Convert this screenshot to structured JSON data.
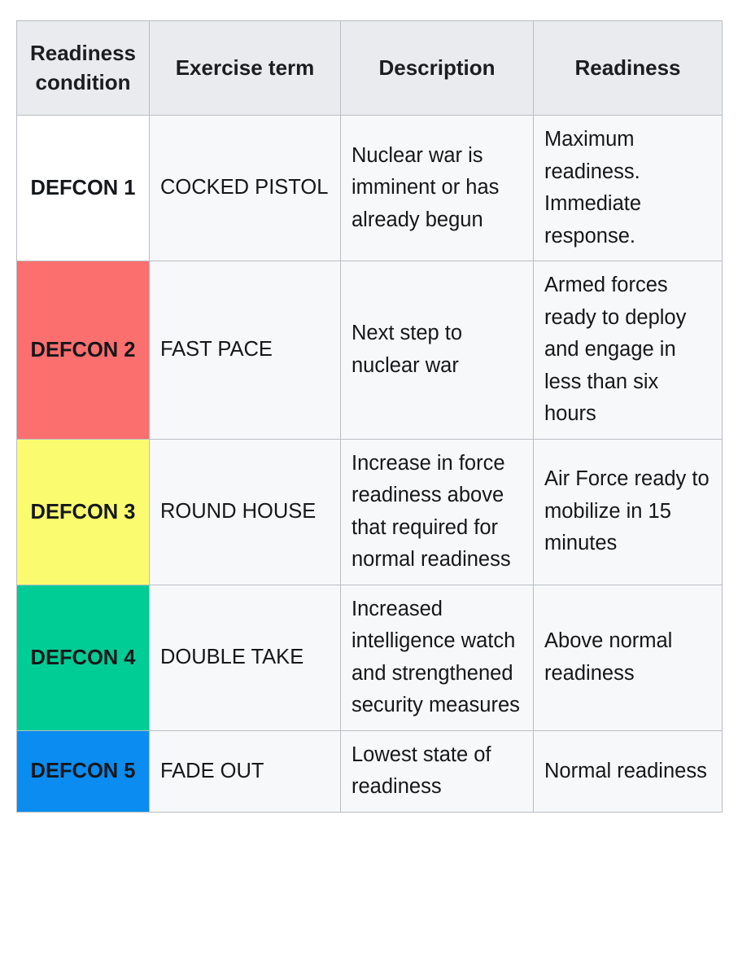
{
  "table": {
    "name": "defcon-readiness-table",
    "columns": [
      {
        "key": "condition",
        "label": "Readiness condition"
      },
      {
        "key": "term",
        "label": "Exercise term"
      },
      {
        "key": "description",
        "label": "Description"
      },
      {
        "key": "readiness",
        "label": "Readiness"
      }
    ],
    "rows": [
      {
        "condition": "DEFCON 1",
        "condition_color": "#ffffff",
        "term": "COCKED PISTOL",
        "description": "Nuclear war is imminent or has already begun",
        "readiness": "Maximum readiness. Immediate response."
      },
      {
        "condition": "DEFCON 2",
        "condition_color": "#fb6f6f",
        "term": "FAST PACE",
        "description": "Next step to nuclear war",
        "readiness": "Armed forces ready to deploy and engage in less than six hours"
      },
      {
        "condition": "DEFCON 3",
        "condition_color": "#fbfb6f",
        "term": "ROUND HOUSE",
        "description": "Increase in force readiness above that required for normal readiness",
        "readiness": "Air Force ready to mobilize in 15 minutes"
      },
      {
        "condition": "DEFCON 4",
        "condition_color": "#00cc96",
        "term": "DOUBLE TAKE",
        "description": "Increased intelligence watch and strengthened security measures",
        "readiness": "Above normal readiness"
      },
      {
        "condition": "DEFCON 5",
        "condition_color": "#0b8cf0",
        "term": "FADE OUT",
        "description": "Lowest state of readiness",
        "readiness": "Normal readiness"
      }
    ]
  },
  "style": {
    "header_background": "#e9ebee",
    "cell_background": "#f7f8fa",
    "border_color": "#b9bdc4",
    "text_color": "#15171a",
    "page_background": "#ffffff"
  }
}
